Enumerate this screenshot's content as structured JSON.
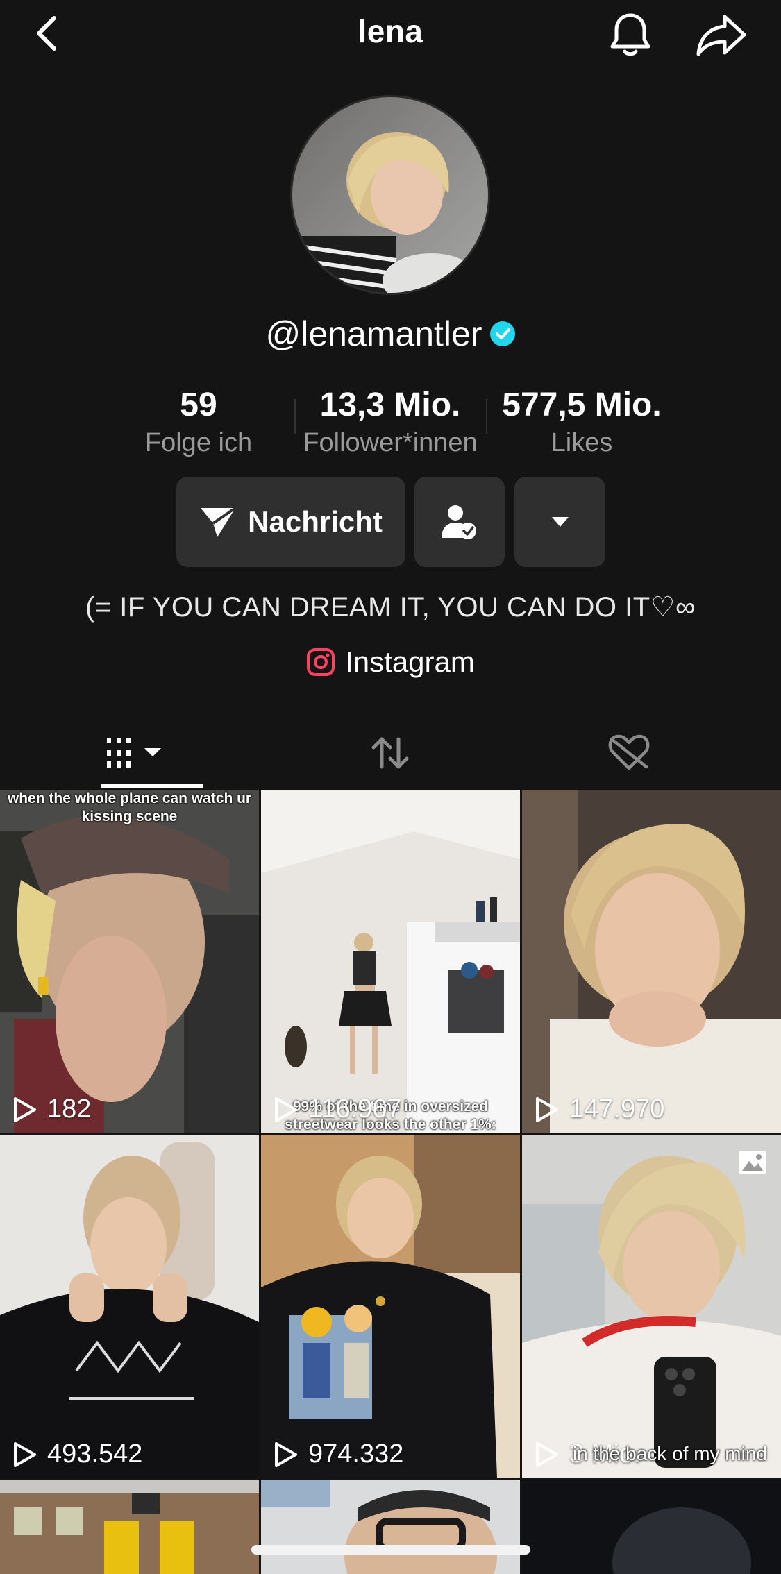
{
  "header": {
    "title": "lena"
  },
  "profile": {
    "handle": "@lenamantler",
    "stats": [
      {
        "value": "59",
        "label": "Folge ich"
      },
      {
        "value": "13,3 Mio.",
        "label": "Follower*innen"
      },
      {
        "value": "577,5 Mio.",
        "label": "Likes"
      }
    ],
    "message_label": "Nachricht",
    "bio": "(= IF YOU CAN DREAM IT, YOU CAN DO IT♡∞",
    "link_label": "Instagram"
  },
  "colors": {
    "background": "#141414",
    "button": "#2f2f2f",
    "verified": "#20d5ec",
    "instagram": "#ff4060"
  },
  "icons": [
    "chevron-left-icon",
    "bell-icon",
    "share-icon",
    "verified-icon",
    "send-icon",
    "friend-check-icon",
    "caret-down-icon",
    "instagram-icon",
    "grid-icon",
    "repost-icon",
    "liked-hidden-icon",
    "play-icon",
    "photo-icon"
  ],
  "videos": [
    {
      "views": "182",
      "caption": "when the whole plane can watch ur kissing scene"
    },
    {
      "views": "116.967",
      "caption": "99% of the time in oversized streetwear looks the other 1%:"
    },
    {
      "views": "147.970",
      "caption": ""
    },
    {
      "views": "493.542",
      "caption": ""
    },
    {
      "views": "974.332",
      "caption": ""
    },
    {
      "views": "3 Mio.",
      "caption": "in the back of my mind"
    }
  ]
}
